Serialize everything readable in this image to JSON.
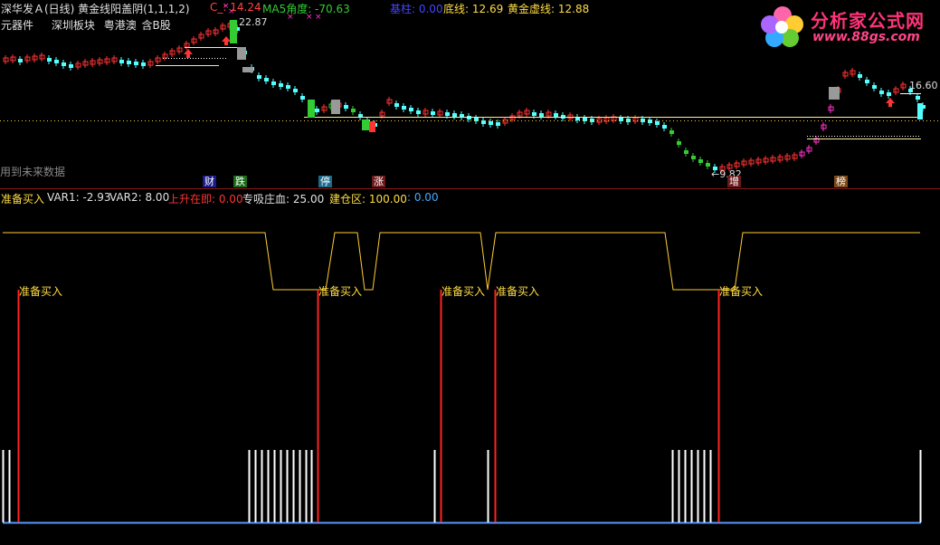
{
  "upper": {
    "title": "深华发Ａ(日线) 黄金线阳盖阴(1,1,1,2)",
    "c_label": "C_: 14.24",
    "ma5_label": "MA5角度: -70.63",
    "jizhu_label": "基柱: 0.00",
    "dixian_label": "底线: 12.69",
    "huangjin_label": "黄金虚线: 12.88",
    "row2_items": [
      "元器件",
      "深圳板块",
      "粤港澳",
      "含B股"
    ],
    "future_data_note": "用到未来数据",
    "price_high": "22.87",
    "price_right": "16.60",
    "price_low": "←9.82",
    "markers": [
      "财",
      "跌",
      "停",
      "涨",
      "增",
      "榜"
    ],
    "colors": {
      "up": "#ff3333",
      "down": "#54ffff",
      "gold": "#ffcc33",
      "magenta": "#ff33cc",
      "green": "#33cc33",
      "gray": "#999999"
    }
  },
  "lower": {
    "label_main": "准备买入",
    "var1": "VAR1: -2.93",
    "var2": "VAR2: 8.00",
    "shangsheng": "上升在即: 0.00",
    "zhuanxi": "专吸庄血: 25.00",
    "jiancang": "建仓区: 100.00",
    "blue_val": ": 0.00",
    "buy_labels": [
      "准备买入",
      "准备买入",
      "准备买入",
      "准备买入",
      "准备买入"
    ]
  },
  "logo": {
    "text": "分析家公式网",
    "url": "www.88gs.com"
  }
}
